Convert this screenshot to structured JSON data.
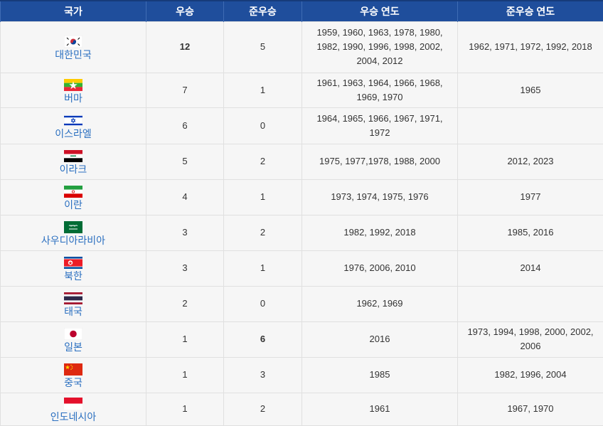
{
  "headers": [
    "국가",
    "우승",
    "준우승",
    "우승 연도",
    "준우승 연도"
  ],
  "rows": [
    {
      "country": "대한민국",
      "flag": "south-korea-flag",
      "wins": "12",
      "runners": "5",
      "win_years": "1959, 1960, 1963, 1978, 1980, 1982, 1990, 1996, 1998, 2002, 2004, 2012",
      "runner_years": "1962, 1971, 1972, 1992, 2018",
      "wins_bold": true,
      "runners_bold": false
    },
    {
      "country": "버마",
      "flag": "myanmar-flag",
      "wins": "7",
      "runners": "1",
      "win_years": "1961, 1963, 1964, 1966, 1968, 1969, 1970",
      "runner_years": "1965",
      "wins_bold": false,
      "runners_bold": false
    },
    {
      "country": "이스라엘",
      "flag": "israel-flag",
      "wins": "6",
      "runners": "0",
      "win_years": "1964, 1965, 1966, 1967, 1971, 1972",
      "runner_years": "",
      "wins_bold": false,
      "runners_bold": false
    },
    {
      "country": "이라크",
      "flag": "iraq-flag",
      "wins": "5",
      "runners": "2",
      "win_years": "1975, 1977,1978, 1988, 2000",
      "runner_years": "2012, 2023",
      "wins_bold": false,
      "runners_bold": false
    },
    {
      "country": "이란",
      "flag": "iran-flag",
      "wins": "4",
      "runners": "1",
      "win_years": "1973, 1974, 1975, 1976",
      "runner_years": "1977",
      "wins_bold": false,
      "runners_bold": false
    },
    {
      "country": "사우디아라비아",
      "flag": "saudi-arabia-flag",
      "wins": "3",
      "runners": "2",
      "win_years": "1982, 1992, 2018",
      "runner_years": "1985, 2016",
      "wins_bold": false,
      "runners_bold": false
    },
    {
      "country": "북한",
      "flag": "north-korea-flag",
      "wins": "3",
      "runners": "1",
      "win_years": "1976, 2006, 2010",
      "runner_years": "2014",
      "wins_bold": false,
      "runners_bold": false
    },
    {
      "country": "태국",
      "flag": "thailand-flag",
      "wins": "2",
      "runners": "0",
      "win_years": "1962, 1969",
      "runner_years": "",
      "wins_bold": false,
      "runners_bold": false
    },
    {
      "country": "일본",
      "flag": "japan-flag",
      "wins": "1",
      "runners": "6",
      "win_years": "2016",
      "runner_years": "1973, 1994, 1998, 2000, 2002, 2006",
      "wins_bold": false,
      "runners_bold": true
    },
    {
      "country": "중국",
      "flag": "china-flag",
      "wins": "1",
      "runners": "3",
      "win_years": "1985",
      "runner_years": "1982, 1996, 2004",
      "wins_bold": false,
      "runners_bold": false
    },
    {
      "country": "인도네시아",
      "flag": "indonesia-flag",
      "wins": "1",
      "runners": "2",
      "win_years": "1961",
      "runner_years": "1967, 1970",
      "wins_bold": false,
      "runners_bold": false
    }
  ]
}
